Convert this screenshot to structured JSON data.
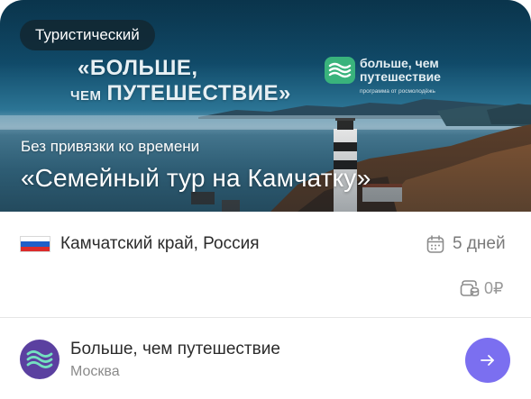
{
  "hero": {
    "tag": "Туристический",
    "promo_line1": "«БОЛЬШЕ,",
    "promo_line2_small": "ЧЕМ",
    "promo_line2": "ПУТЕШЕСТВИЕ»",
    "brand_name": "больше, чем путешествие",
    "brand_sub": "программа от росмолодёжь",
    "subtitle": "Без привязки ко времени",
    "title": "«Семейный тур на Камчатку»"
  },
  "info": {
    "flag_colors": [
      "#ffffff",
      "#1f5fc9",
      "#dc2b2b"
    ],
    "location": "Камчатский край, Россия",
    "duration_icon": "calendar-icon",
    "duration": "5 дней",
    "price_icon": "wallet-coins-icon",
    "price": "0₽"
  },
  "organizer": {
    "name": "Больше, чем путешествие",
    "city": "Москва",
    "button_icon": "arrow-right-icon"
  },
  "colors": {
    "accent": "#7b6ff0",
    "tag_bg": "#122630",
    "brand_green": "#39b37c",
    "avatar_bg": "#5b40a0"
  }
}
